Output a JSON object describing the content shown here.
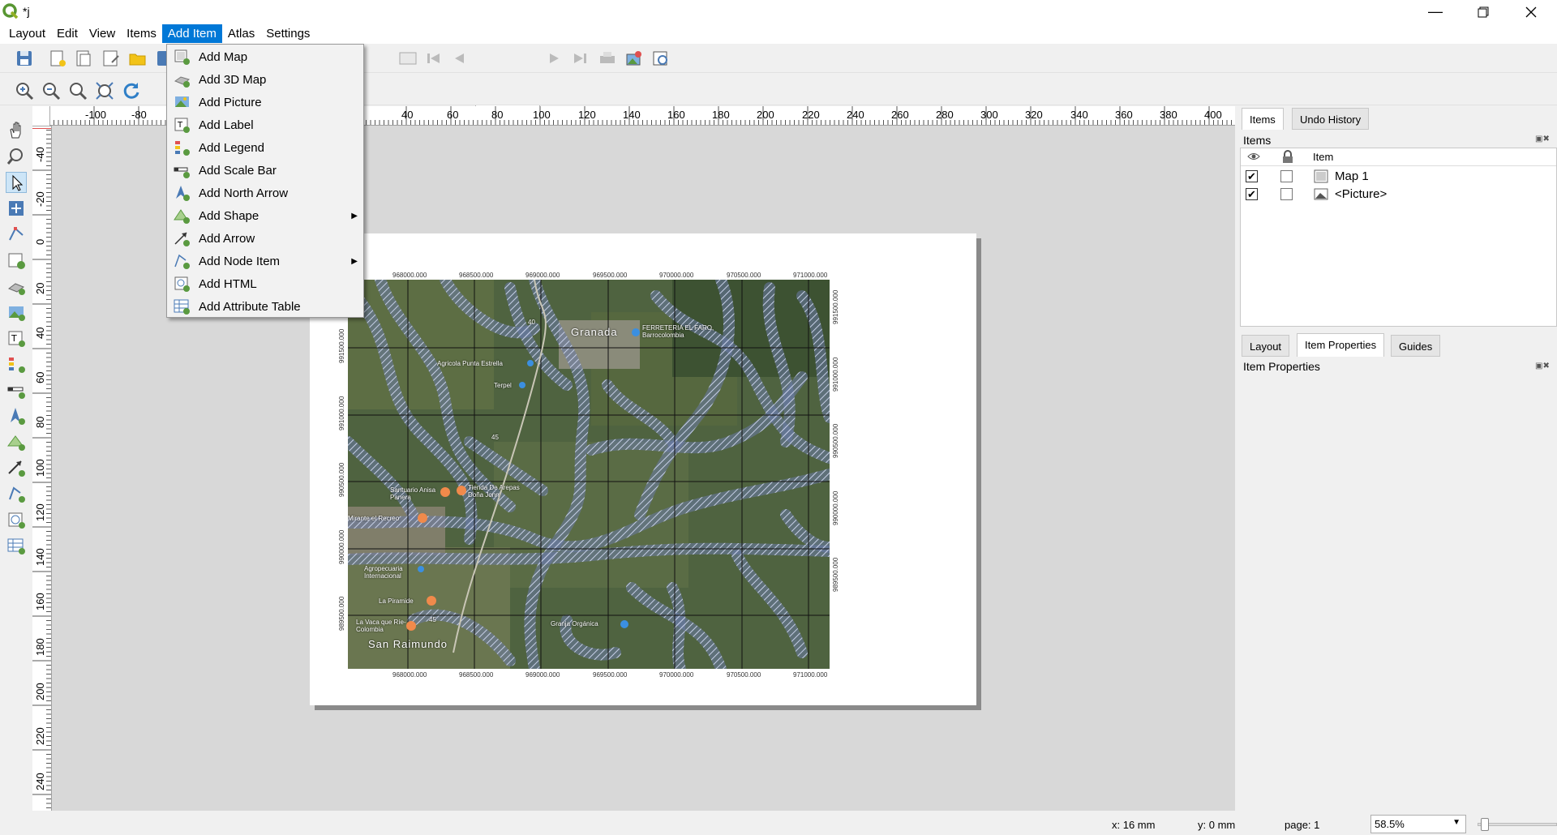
{
  "window": {
    "title": "*j"
  },
  "menubar": {
    "items": [
      "Layout",
      "Edit",
      "View",
      "Items",
      "Add Item",
      "Atlas",
      "Settings"
    ],
    "active": "Add Item"
  },
  "toolbar": {
    "page_number": "1"
  },
  "add_item_menu": {
    "items": [
      {
        "label": "Add Map",
        "icon": "map-add-icon",
        "submenu": false
      },
      {
        "label": "Add 3D Map",
        "icon": "map-3d-add-icon",
        "submenu": false
      },
      {
        "label": "Add Picture",
        "icon": "picture-add-icon",
        "submenu": false
      },
      {
        "label": "Add Label",
        "icon": "label-add-icon",
        "submenu": false
      },
      {
        "label": "Add Legend",
        "icon": "legend-add-icon",
        "submenu": false
      },
      {
        "label": "Add Scale Bar",
        "icon": "scalebar-add-icon",
        "submenu": false
      },
      {
        "label": "Add North Arrow",
        "icon": "north-arrow-add-icon",
        "submenu": false
      },
      {
        "label": "Add Shape",
        "icon": "shape-add-icon",
        "submenu": true
      },
      {
        "label": "Add Arrow",
        "icon": "arrow-add-icon",
        "submenu": false
      },
      {
        "label": "Add Node Item",
        "icon": "node-item-add-icon",
        "submenu": true
      },
      {
        "label": "Add HTML",
        "icon": "html-add-icon",
        "submenu": false
      },
      {
        "label": "Add Attribute Table",
        "icon": "attribute-table-add-icon",
        "submenu": false
      }
    ]
  },
  "ruler_top": {
    "labels": [
      "-100",
      "-80",
      "40",
      "60",
      "80",
      "100",
      "120",
      "140",
      "160",
      "180",
      "200",
      "220",
      "240",
      "260",
      "280",
      "300",
      "320",
      "340",
      "360",
      "380",
      "400"
    ]
  },
  "ruler_left": {
    "labels": [
      "-40",
      "-20",
      "0",
      "20",
      "40",
      "60",
      "80",
      "100",
      "120",
      "140",
      "160",
      "180",
      "200",
      "220",
      "240"
    ]
  },
  "map": {
    "x_coords": [
      "968000.000",
      "968500.000",
      "969000.000",
      "969500.000",
      "970000.000",
      "970500.000",
      "971000.000"
    ],
    "y_coords_left": [
      "991500.000",
      "991000.000",
      "990500.000",
      "990000.000",
      "989500.000"
    ],
    "y_coords_right": [
      "991500.000",
      "991000.000",
      "990500.000",
      "990000.000",
      "989500.000"
    ],
    "labels": {
      "granada": "Granada",
      "ferreteria": "FERRETERIA EL FARO, Barrocolombia",
      "agricola": "Agricola Punta Estrella",
      "terpel": "Terpel",
      "santuario": "Santuario Anisa Panera",
      "tienda": "Tienda De Arepas Doña Jonn",
      "mirador": "Mirante el Recreo",
      "agropecuaria": "Agropecuaria Internacional",
      "piramide": "La Piramide",
      "vaca": "La Vaca que Ríe- Colombia",
      "granja": "Granja Orgánica",
      "san_raimundo": "San Raimundo",
      "route_top": "40",
      "route_mid": "45",
      "route_bottom": "45"
    }
  },
  "dock": {
    "top_tabs": [
      "Items",
      "Undo History"
    ],
    "items_panel_title": "Items",
    "tree_header": "Item",
    "tree_rows": [
      {
        "label": "Map 1",
        "visible": true,
        "locked": false
      },
      {
        "label": "<Picture>",
        "visible": true,
        "locked": false
      }
    ],
    "bottom_tabs": [
      "Layout",
      "Item Properties",
      "Guides"
    ],
    "properties_title": "Item Properties"
  },
  "statusbar": {
    "x": "x: 16 mm",
    "y": "y: 0 mm",
    "page": "page: 1",
    "zoom": "58.5%"
  }
}
